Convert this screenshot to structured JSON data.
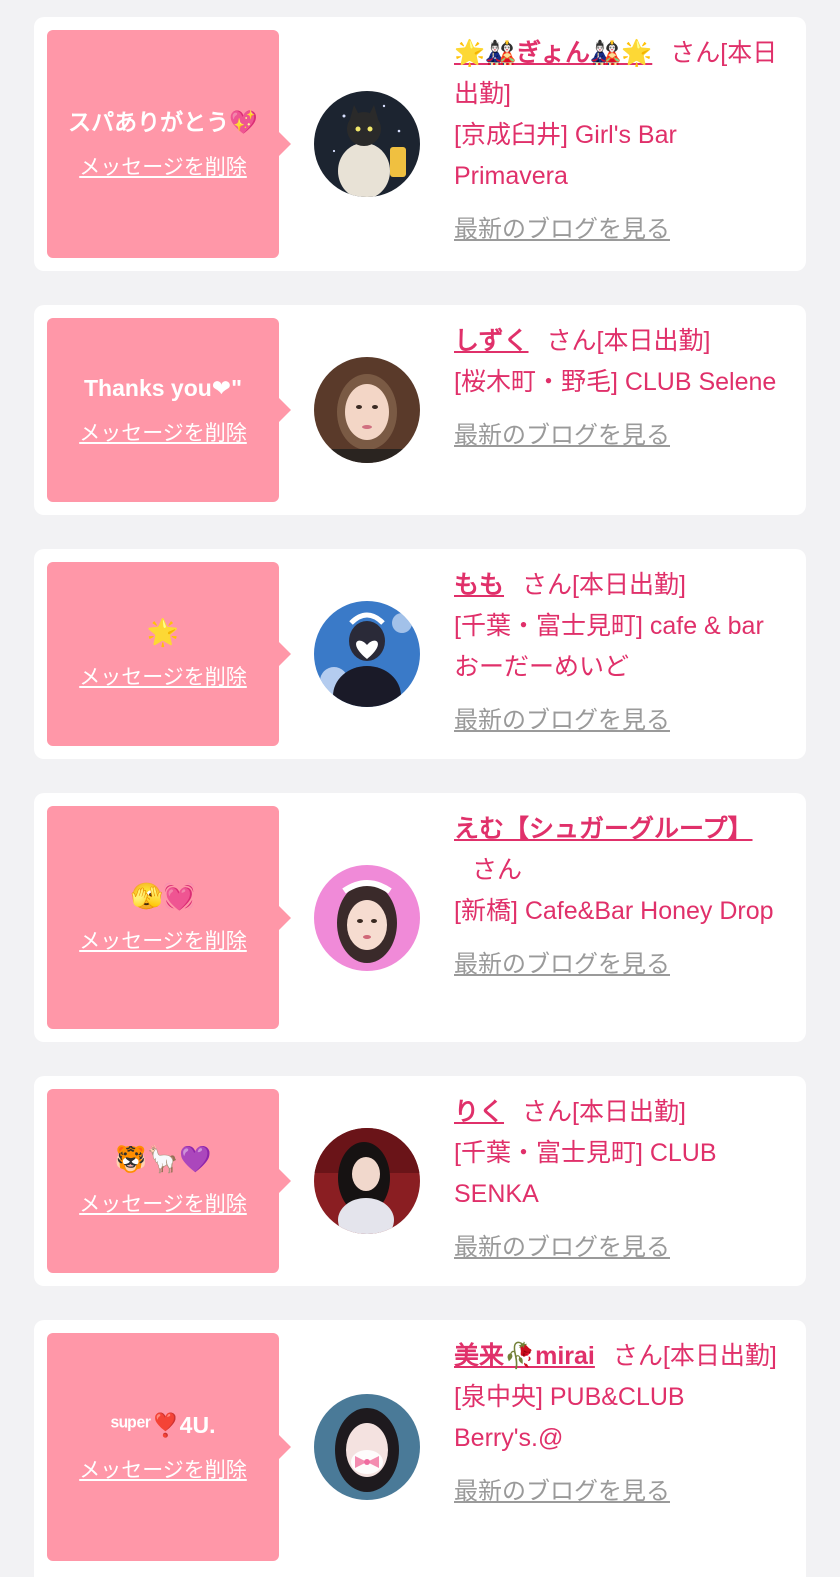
{
  "colors": {
    "bubble": "#ff97a8",
    "accent": "#e0306a",
    "link_gray": "#9a9a9a",
    "card": "#ffffff",
    "page": "#f2f2f4"
  },
  "delete_label": "メッセージを削除",
  "blog_label": "最新のブログを見る",
  "san_label": "さん",
  "items": [
    {
      "message": "スパありがとう💖",
      "name": "🌟🎎ぎょん🎎🌟",
      "status": "[本日出勤]",
      "shop": "[京成臼井] Girl's Bar Primavera",
      "avatar_icon": "cat-photo-avatar"
    },
    {
      "message": "Thanks you❤\"",
      "name": "しずく",
      "status": "[本日出勤]",
      "shop": "[桜木町・野毛] CLUB Selene",
      "avatar_icon": "woman-portrait-avatar"
    },
    {
      "message": "🌟",
      "name": "もも",
      "status": "[本日出勤]",
      "shop": "[千葉・富士見町] cafe & bar おーだーめいど",
      "avatar_icon": "maid-photo-avatar"
    },
    {
      "message": "🫣💓",
      "name": "えむ【シュガーグループ】",
      "status": "",
      "shop": "[新橋] Cafe&Bar Honey Drop",
      "avatar_icon": "maid-portrait-avatar"
    },
    {
      "message": "🐯🦙💜",
      "name": "りく",
      "status": "[本日出勤]",
      "shop": "[千葉・富士見町] CLUB SENKA",
      "avatar_icon": "woman-red-sofa-avatar"
    },
    {
      "message": "ˢᵘᵖᵉʳ❣️4U.",
      "name": "美来🥀mirai",
      "status": "[本日出勤]",
      "shop": "[泉中央] PUB&CLUB Berry's.@",
      "avatar_icon": "woman-bow-avatar"
    }
  ]
}
